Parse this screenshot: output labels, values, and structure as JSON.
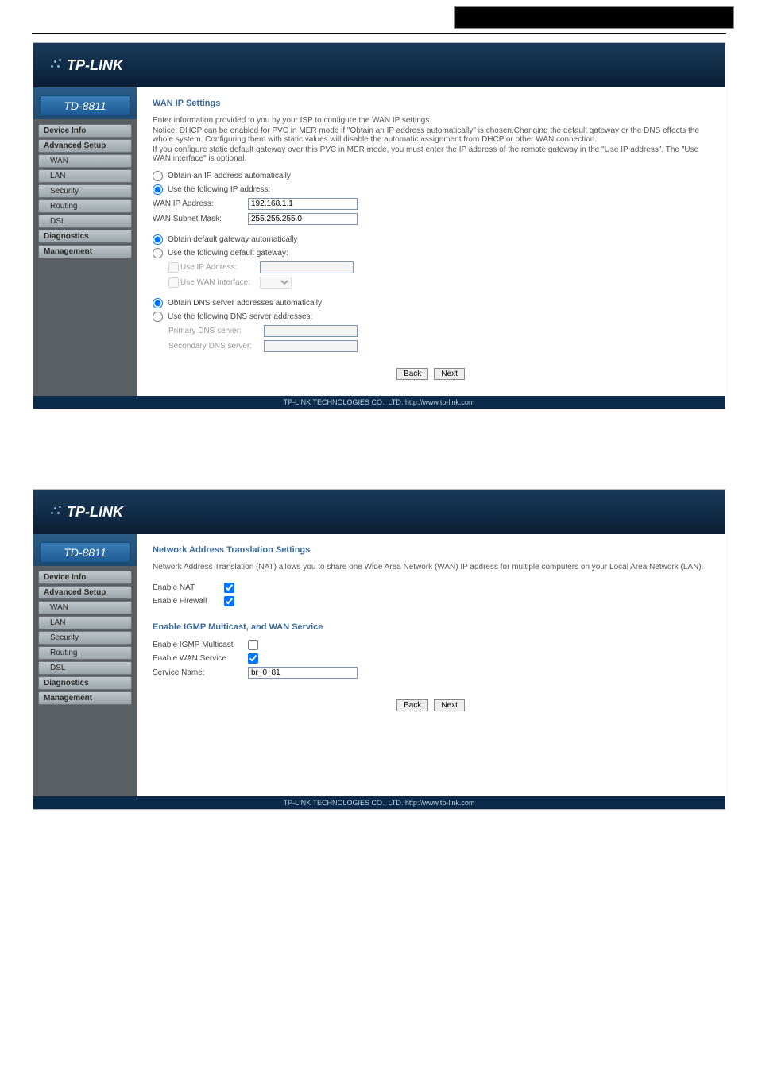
{
  "brand": "TP-LINK",
  "model": "TD-8811",
  "footer": "TP-LINK TECHNOLOGIES CO., LTD. http://www.tp-link.com",
  "nav": {
    "device_info": "Device Info",
    "advanced_setup": "Advanced Setup",
    "wan": "WAN",
    "lan": "LAN",
    "security": "Security",
    "routing": "Routing",
    "dsl": "DSL",
    "diagnostics": "Diagnostics",
    "management": "Management"
  },
  "wanip": {
    "title": "WAN IP Settings",
    "desc1": "Enter information provided to you by your ISP to configure the WAN IP settings.",
    "desc2": "Notice: DHCP can be enabled for PVC in MER mode if \"Obtain an IP address automatically\" is chosen.Changing the default gateway or the DNS effects the whole system. Configuring them with static values will disable the automatic assignment from DHCP or other WAN connection.",
    "desc3": "If you configure static default gateway over this PVC in MER mode, you must enter the IP address of the remote gateway in the \"Use IP address\". The \"Use WAN interface\" is optional.",
    "opt_auto": "Obtain an IP address automatically",
    "opt_static": "Use the following IP address:",
    "ip_label": "WAN IP Address:",
    "ip_value": "192.168.1.1",
    "mask_label": "WAN Subnet Mask:",
    "mask_value": "255.255.255.0",
    "gw_auto": "Obtain default gateway automatically",
    "gw_static": "Use the following default gateway:",
    "use_ip": "Use IP Address:",
    "use_wan": "Use WAN Interface:",
    "dns_auto": "Obtain DNS server addresses automatically",
    "dns_static": "Use the following DNS server addresses:",
    "dns1": "Primary DNS server:",
    "dns2": "Secondary DNS server:"
  },
  "nat": {
    "title": "Network Address Translation Settings",
    "desc": "Network Address Translation (NAT) allows you to share one Wide Area Network (WAN) IP address for multiple computers on your Local Area Network (LAN).",
    "enable_nat": "Enable NAT",
    "enable_fw": "Enable Firewall",
    "section2": "Enable IGMP Multicast, and WAN Service",
    "enable_igmp": "Enable IGMP Multicast",
    "enable_wan": "Enable WAN Service",
    "service_label": "Service Name:",
    "service_value": "br_0_81"
  },
  "buttons": {
    "back": "Back",
    "next": "Next"
  }
}
